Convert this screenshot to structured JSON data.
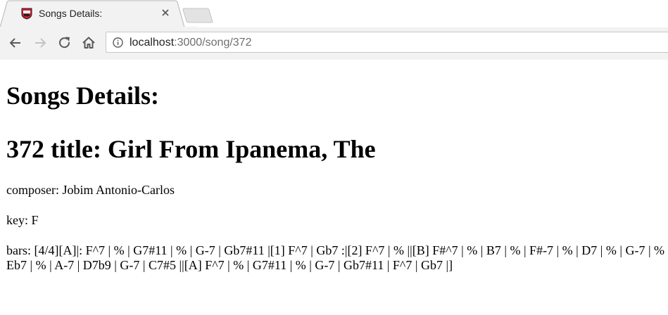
{
  "browser": {
    "tab_title": "Songs Details:",
    "url_host": "localhost",
    "url_rest": ":3000/song/372",
    "icons": {
      "back": "back-arrow-icon",
      "forward": "forward-arrow-icon",
      "reload": "reload-icon",
      "home": "home-icon",
      "info": "info-icon",
      "close": "close-icon",
      "favicon": "shield-favicon-icon"
    }
  },
  "page": {
    "heading": "Songs Details:",
    "song_heading": "372 title: Girl From Ipanema, The",
    "composer": "composer: Jobim Antonio-Carlos",
    "key": "key: F",
    "bars": "bars: [4/4][A]|: F^7 | % | G7#11 | % | G-7 | Gb7#11 |[1] F^7 | Gb7 :|[2] F^7 | % ||[B] F#^7 | % | B7 | % | F#-7 | % | D7 | % | G-7 | % | Eb7 | % | A-7 | D7b9 | G-7 | C7#5 ||[A] F^7 | % | G7#11 | % | G-7 | Gb7#11 | F^7 | Gb7 |]"
  },
  "colors": {
    "chrome_bg": "#f2f2f2",
    "text": "#000000",
    "url_muted": "#6f6f6f"
  }
}
